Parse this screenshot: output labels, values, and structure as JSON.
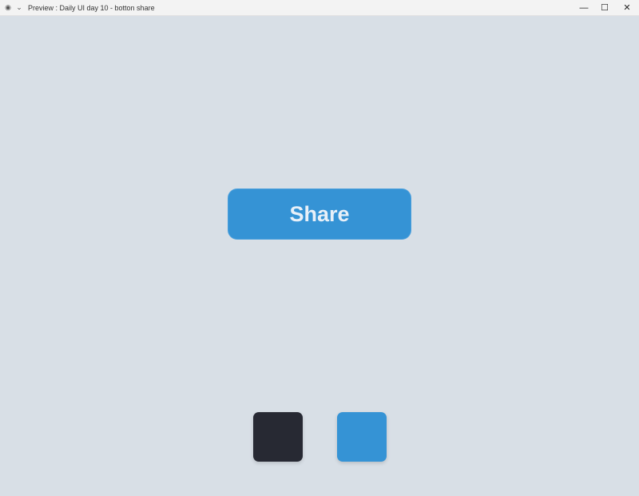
{
  "window": {
    "title": "Preview : Daily UI day 10 - botton share",
    "controls": [
      "minimize",
      "maximize",
      "close"
    ]
  },
  "main": {
    "share_label": "Share",
    "swatches": [
      {
        "color": "#272933"
      },
      {
        "color": "#3593d5"
      }
    ]
  },
  "colors": {
    "background": "#d8dfe6",
    "accent": "#3593d5"
  }
}
